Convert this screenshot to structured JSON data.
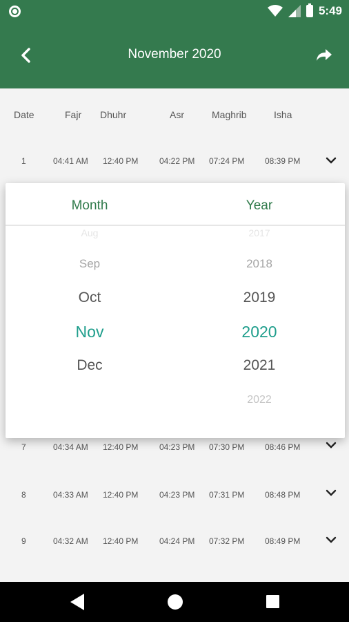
{
  "status_bar": {
    "time": "5:49",
    "icons": [
      "record-icon",
      "wifi-icon",
      "signal-icon",
      "battery-icon"
    ]
  },
  "app_bar": {
    "title": "November 2020",
    "back_icon": "chevron-left-icon",
    "share_icon": "share-arrow-icon"
  },
  "table": {
    "headers": [
      "Date",
      "Fajr",
      "Dhuhr",
      "Asr",
      "Maghrib",
      "Isha"
    ],
    "rows": [
      {
        "date": "1",
        "fajr": "04:41 AM",
        "dhuhr": "12:40 PM",
        "asr": "04:22 PM",
        "maghrib": "07:24 PM",
        "isha": "08:39 PM"
      },
      {
        "date": "7",
        "fajr": "04:34 AM",
        "dhuhr": "12:40 PM",
        "asr": "04:23 PM",
        "maghrib": "07:30 PM",
        "isha": "08:46 PM"
      },
      {
        "date": "8",
        "fajr": "04:33 AM",
        "dhuhr": "12:40 PM",
        "asr": "04:23 PM",
        "maghrib": "07:31 PM",
        "isha": "08:48 PM"
      },
      {
        "date": "9",
        "fajr": "04:32 AM",
        "dhuhr": "12:40 PM",
        "asr": "04:24 PM",
        "maghrib": "07:32 PM",
        "isha": "08:49 PM"
      }
    ]
  },
  "picker": {
    "month_title": "Month",
    "year_title": "Year",
    "months": [
      "Aug",
      "Sep",
      "Oct",
      "Nov",
      "Dec"
    ],
    "selected_month": "Nov",
    "years": [
      "2017",
      "2018",
      "2019",
      "2020",
      "2021",
      "2022"
    ],
    "selected_year": "2020",
    "colors": {
      "accent_green": "#2f7a4a",
      "selected_teal": "#1f9e8c"
    }
  },
  "theme": {
    "primary": "#347a4e",
    "background": "#f3f3f3"
  },
  "nav_bar": {
    "icons": [
      "back-triangle-icon",
      "home-circle-icon",
      "recents-square-icon"
    ]
  }
}
